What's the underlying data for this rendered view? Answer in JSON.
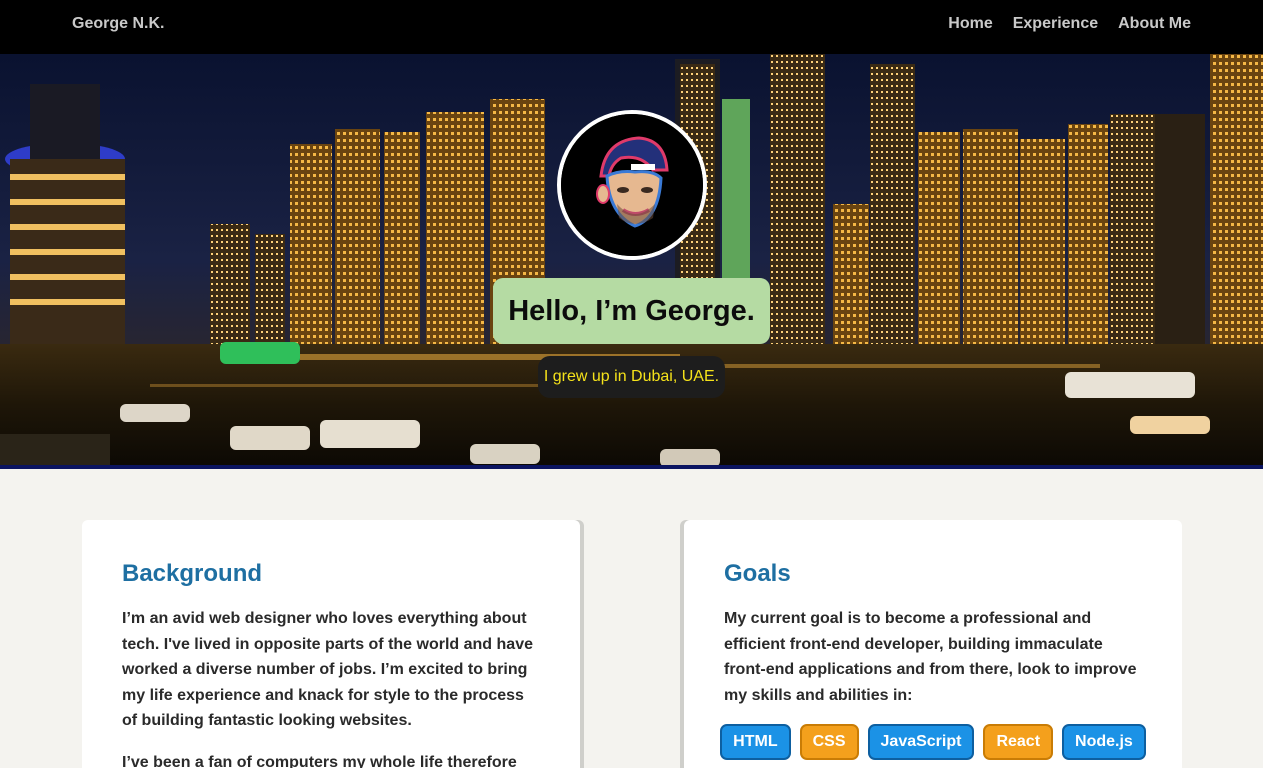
{
  "nav": {
    "brand": "George N.K.",
    "links": [
      "Home",
      "Experience",
      "About Me"
    ]
  },
  "hero": {
    "heading": "Hello, I’m George.",
    "subheading": "I grew up in Dubai, UAE."
  },
  "background": {
    "title": "Background",
    "paragraphs": [
      "I’m an avid web designer who loves everything about tech. I've lived in opposite parts of the world and have worked a diverse number of jobs. I’m excited to bring my life experience and knack for style to the process of building fantastic looking websites.",
      "I’ve been a fan of computers my whole life therefore I’m"
    ]
  },
  "goals": {
    "title": "Goals",
    "paragraph": "My current goal is to become a professional and efficient front-end developer, building immaculate front-end applications and from there, look to improve my skills and abilities in:",
    "skills": [
      "HTML",
      "CSS",
      "JavaScript",
      "React",
      "Node.js"
    ]
  },
  "colors": {
    "accent_blue": "#1e6fa2",
    "hello_bg": "#b5dba3",
    "subtag_text": "#f5e21a",
    "chip_blue": "#1b92e6",
    "chip_orange": "#f4a01c"
  }
}
